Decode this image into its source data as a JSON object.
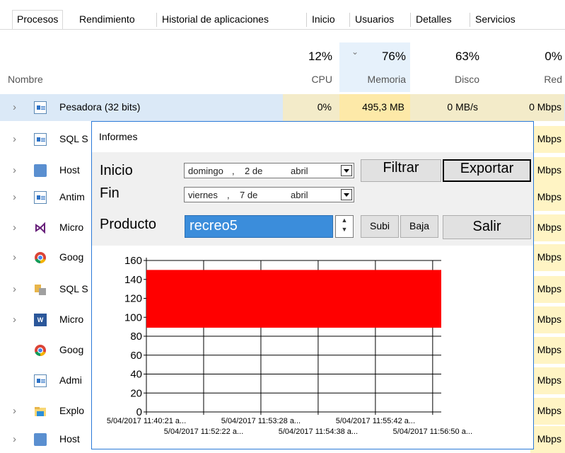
{
  "tabs": [
    "Procesos",
    "Rendimiento",
    "Historial de aplicaciones",
    "Inicio",
    "Usuarios",
    "Detalles",
    "Servicios"
  ],
  "header": {
    "name_label": "Nombre",
    "cpu": {
      "pct": "12%",
      "label": "CPU"
    },
    "memory": {
      "pct": "76%",
      "label": "Memoria"
    },
    "disk": {
      "pct": "63%",
      "label": "Disco"
    },
    "network": {
      "pct": "0%",
      "label": "Red"
    }
  },
  "processes": [
    {
      "name": "Pesadora (32 bits)",
      "cpu": "0%",
      "memory": "495,3 MB",
      "disk": "0 MB/s",
      "network": "0 Mbps",
      "icon": "app-window-icon",
      "expandable": true
    },
    {
      "name": "SQL S",
      "network": "Mbps",
      "icon": "app-window-icon",
      "expandable": true
    },
    {
      "name": "Host",
      "network": "Mbps",
      "icon": "gear-service-icon",
      "expandable": true
    },
    {
      "name": "Antim",
      "network": "Mbps",
      "icon": "app-window-icon",
      "expandable": true
    },
    {
      "name": "Micro",
      "network": "Mbps",
      "icon": "visual-studio-icon",
      "expandable": true
    },
    {
      "name": "Goog",
      "network": "Mbps",
      "icon": "chrome-icon",
      "expandable": true
    },
    {
      "name": "SQL S",
      "network": "Mbps",
      "icon": "sql-server-icon",
      "expandable": true
    },
    {
      "name": "Micro",
      "network": "Mbps",
      "icon": "word-icon",
      "expandable": true
    },
    {
      "name": "Goog",
      "network": "Mbps",
      "icon": "chrome-icon",
      "expandable": false
    },
    {
      "name": "Admi",
      "network": "Mbps",
      "icon": "app-window-icon",
      "expandable": false
    },
    {
      "name": "Explo",
      "network": "Mbps",
      "icon": "folder-icon",
      "expandable": true
    },
    {
      "name": "Host",
      "network": "Mbps",
      "icon": "gear-service-icon",
      "expandable": true
    }
  ],
  "dialog": {
    "title": "Informes",
    "inicio_label": "Inicio",
    "inicio_value": {
      "weekday": "domingo",
      "sep": ",",
      "day": "2 de",
      "month": "abril"
    },
    "fin_label": "Fin",
    "fin_value": {
      "weekday": "viernes",
      "sep": ",",
      "day": "7 de",
      "month": "abril"
    },
    "producto_label": "Producto",
    "producto_value": "recreo5",
    "buttons": {
      "filtrar": "Filtrar",
      "exportar": "Exportar",
      "subi": "Subi",
      "baja": "Baja",
      "salir": "Salir"
    }
  },
  "chart_data": {
    "type": "area",
    "y_ticks": [
      "0",
      "20",
      "40",
      "60",
      "80",
      "100",
      "120",
      "140",
      "160"
    ],
    "ylim": [
      0,
      160
    ],
    "x_ticks_row1": [
      "5/04/2017 11:40:21 a...",
      "5/04/2017 11:53:28 a...",
      "5/04/2017 11:55:42 a..."
    ],
    "x_ticks_row2": [
      "5/04/2017 11:52:22 a...",
      "5/04/2017 11:54:38 a...",
      "5/04/2017 11:56:50 a..."
    ],
    "band": {
      "low": 89,
      "high": 150,
      "color": "#ff0000"
    },
    "grid": true
  },
  "colors": {
    "selection_blue": "#3b8ddb",
    "memory_highlight": "#fff4c4",
    "dialog_border": "#2b7ad8",
    "chart_fill": "#ff0000"
  }
}
